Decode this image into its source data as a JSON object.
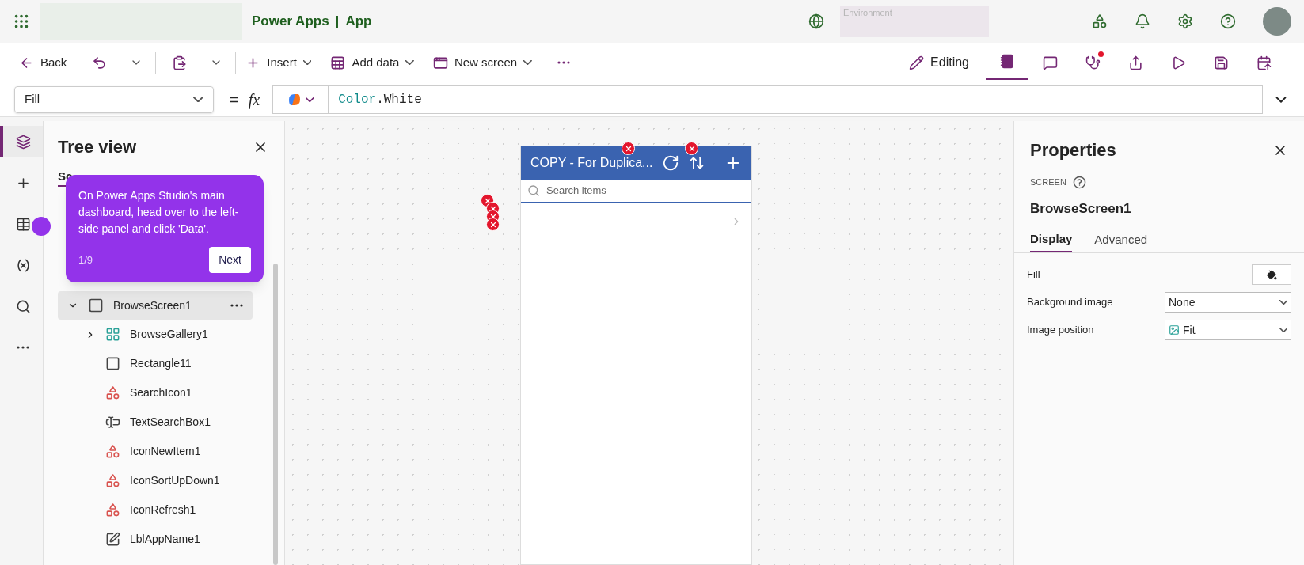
{
  "app_bar": {
    "title": "Power Apps",
    "separator": "|",
    "app": "App",
    "environment_label": "Environment"
  },
  "toolbar": {
    "left": [
      {
        "kind": "back",
        "label": "Back"
      },
      {
        "kind": "undo"
      },
      {
        "kind": "paste"
      },
      {
        "kind": "insert",
        "label": "Insert"
      },
      {
        "kind": "add_data",
        "label": "Add data"
      },
      {
        "kind": "new_screen",
        "label": "New screen"
      },
      {
        "kind": "more"
      }
    ],
    "editing": "Editing",
    "right": [
      {
        "kind": "notes",
        "selected": true,
        "alert": false
      },
      {
        "kind": "comments",
        "selected": false,
        "alert": false
      },
      {
        "kind": "checker",
        "selected": false,
        "alert": true
      },
      {
        "kind": "share",
        "selected": false,
        "alert": false
      },
      {
        "kind": "play",
        "selected": false,
        "alert": false
      },
      {
        "kind": "save",
        "selected": false,
        "alert": false
      },
      {
        "kind": "publish",
        "selected": false,
        "alert": false
      }
    ]
  },
  "formula_bar": {
    "property": "Fill",
    "equals": "=",
    "function_label": "fx",
    "object": "Color",
    "member": ".White"
  },
  "rail": [
    {
      "kind": "layers",
      "selected": true
    },
    {
      "kind": "insert",
      "selected": false
    },
    {
      "kind": "data",
      "selected": false
    },
    {
      "kind": "variables",
      "selected": false
    },
    {
      "kind": "search",
      "selected": false
    },
    {
      "kind": "more",
      "selected": false
    }
  ],
  "tree": {
    "title": "Tree view",
    "tabs": [
      {
        "label": "Sc",
        "selected": true
      }
    ],
    "items": [
      {
        "label": "BrowseScreen1",
        "kind": "screen",
        "expanded": true,
        "selected": true,
        "children": [
          {
            "label": "BrowseGallery1",
            "kind": "gallery",
            "expanded": false,
            "selected": false
          },
          {
            "label": "Rectangle11",
            "kind": "rectangle",
            "selected": false
          },
          {
            "label": "SearchIcon1",
            "kind": "icon",
            "selected": false
          },
          {
            "label": "TextSearchBox1",
            "kind": "textbox",
            "selected": false
          },
          {
            "label": "IconNewItem1",
            "kind": "icon",
            "selected": false
          },
          {
            "label": "IconSortUpDown1",
            "kind": "icon",
            "selected": false
          },
          {
            "label": "IconRefresh1",
            "kind": "icon",
            "selected": false
          },
          {
            "label": "LblAppName1",
            "kind": "label",
            "selected": false
          }
        ]
      }
    ]
  },
  "tooltip": {
    "text": "On Power Apps Studio's main dashboard, head over to the left-side panel and click 'Data'.",
    "step": "1/9",
    "button": "Next"
  },
  "canvas": {
    "header": "COPY - For Duplica...",
    "search_placeholder": "Search items"
  },
  "properties": {
    "title": "Properties",
    "type": "SCREEN",
    "name": "BrowseScreen1",
    "tabs": [
      {
        "label": "Display",
        "selected": true
      },
      {
        "label": "Advanced",
        "selected": false
      }
    ],
    "rows": [
      {
        "label": "Fill",
        "kind": "color"
      },
      {
        "label": "Background image",
        "kind": "dropdown",
        "value": "None"
      },
      {
        "label": "Image position",
        "kind": "image_dropdown",
        "value": "Fit"
      }
    ]
  }
}
